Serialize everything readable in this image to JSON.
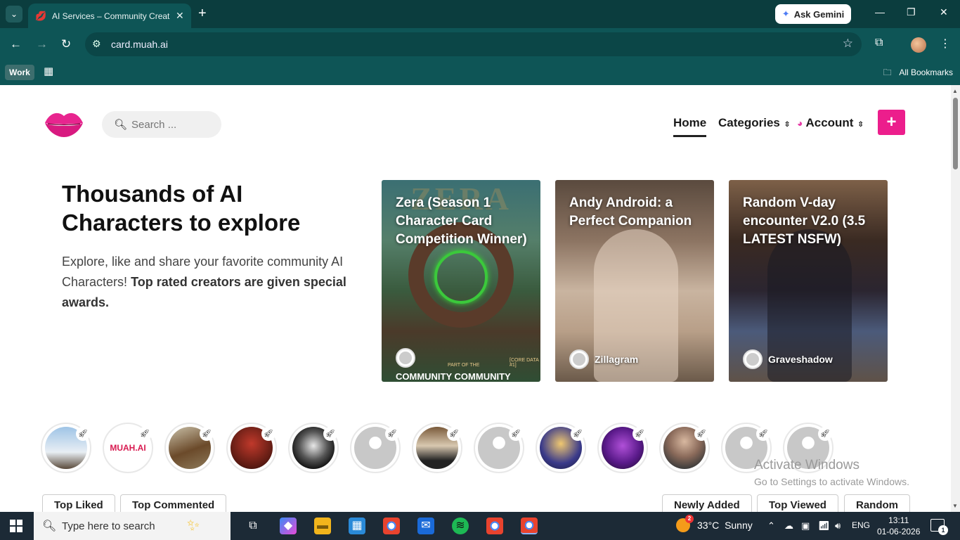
{
  "browser": {
    "tab_title": "AI Services – Community Creations",
    "new_tab": "+",
    "gemini_label": "Ask Gemini",
    "url": "card.muah.ai",
    "bookmark_work": "Work",
    "all_bookmarks": "All Bookmarks"
  },
  "site": {
    "search_placeholder": "Search ...",
    "nav": {
      "home": "Home",
      "categories": "Categories",
      "account": "Account"
    },
    "add_label": "+"
  },
  "hero": {
    "title": "Thousands of AI Characters to explore",
    "subtitle_plain": "Explore, like and share your favorite community AI Characters!",
    "subtitle_bold": "Top rated creators are given special awards."
  },
  "cards": [
    {
      "title": "Zera (Season 1 Character Card Competition Winner)",
      "author": "COMMUNITY COMMUNITY",
      "inner_text": "PART OF THE",
      "inner_text2": "[CORE DATA #1]",
      "logo_text": "ZERA"
    },
    {
      "title": "Andy Android: a Perfect Companion",
      "author": "Zillagram"
    },
    {
      "title": "Random V-day encounter V2.0 (3.5 LATEST NSFW)",
      "author": "Graveshadow"
    }
  ],
  "avatar_tiles": [
    "eagle",
    "lips-muah",
    "horse",
    "red-man",
    "robot-monster",
    "placeholder",
    "photo-man",
    "placeholder",
    "anime-blonde",
    "purple-alien",
    "bald-bearded-man",
    "placeholder",
    "placeholder"
  ],
  "avatar_logo_text": "MUAH.AI",
  "filters_left": [
    "Top Liked",
    "Top Commented"
  ],
  "filters_right": [
    "Newly Added",
    "Top Viewed",
    "Random"
  ],
  "watermark": {
    "line1": "Activate Windows",
    "line2": "Go to Settings to activate Windows."
  },
  "taskbar": {
    "search_placeholder": "Type here to search",
    "weather_badge": "2",
    "temperature": "33°C",
    "condition": "Sunny",
    "language": "ENG",
    "time": "13:11",
    "date": "01-06-2026",
    "notifications": "1"
  },
  "colors": {
    "browser_frame": "#0e5556",
    "accent_pink": "#ec1e8c"
  }
}
